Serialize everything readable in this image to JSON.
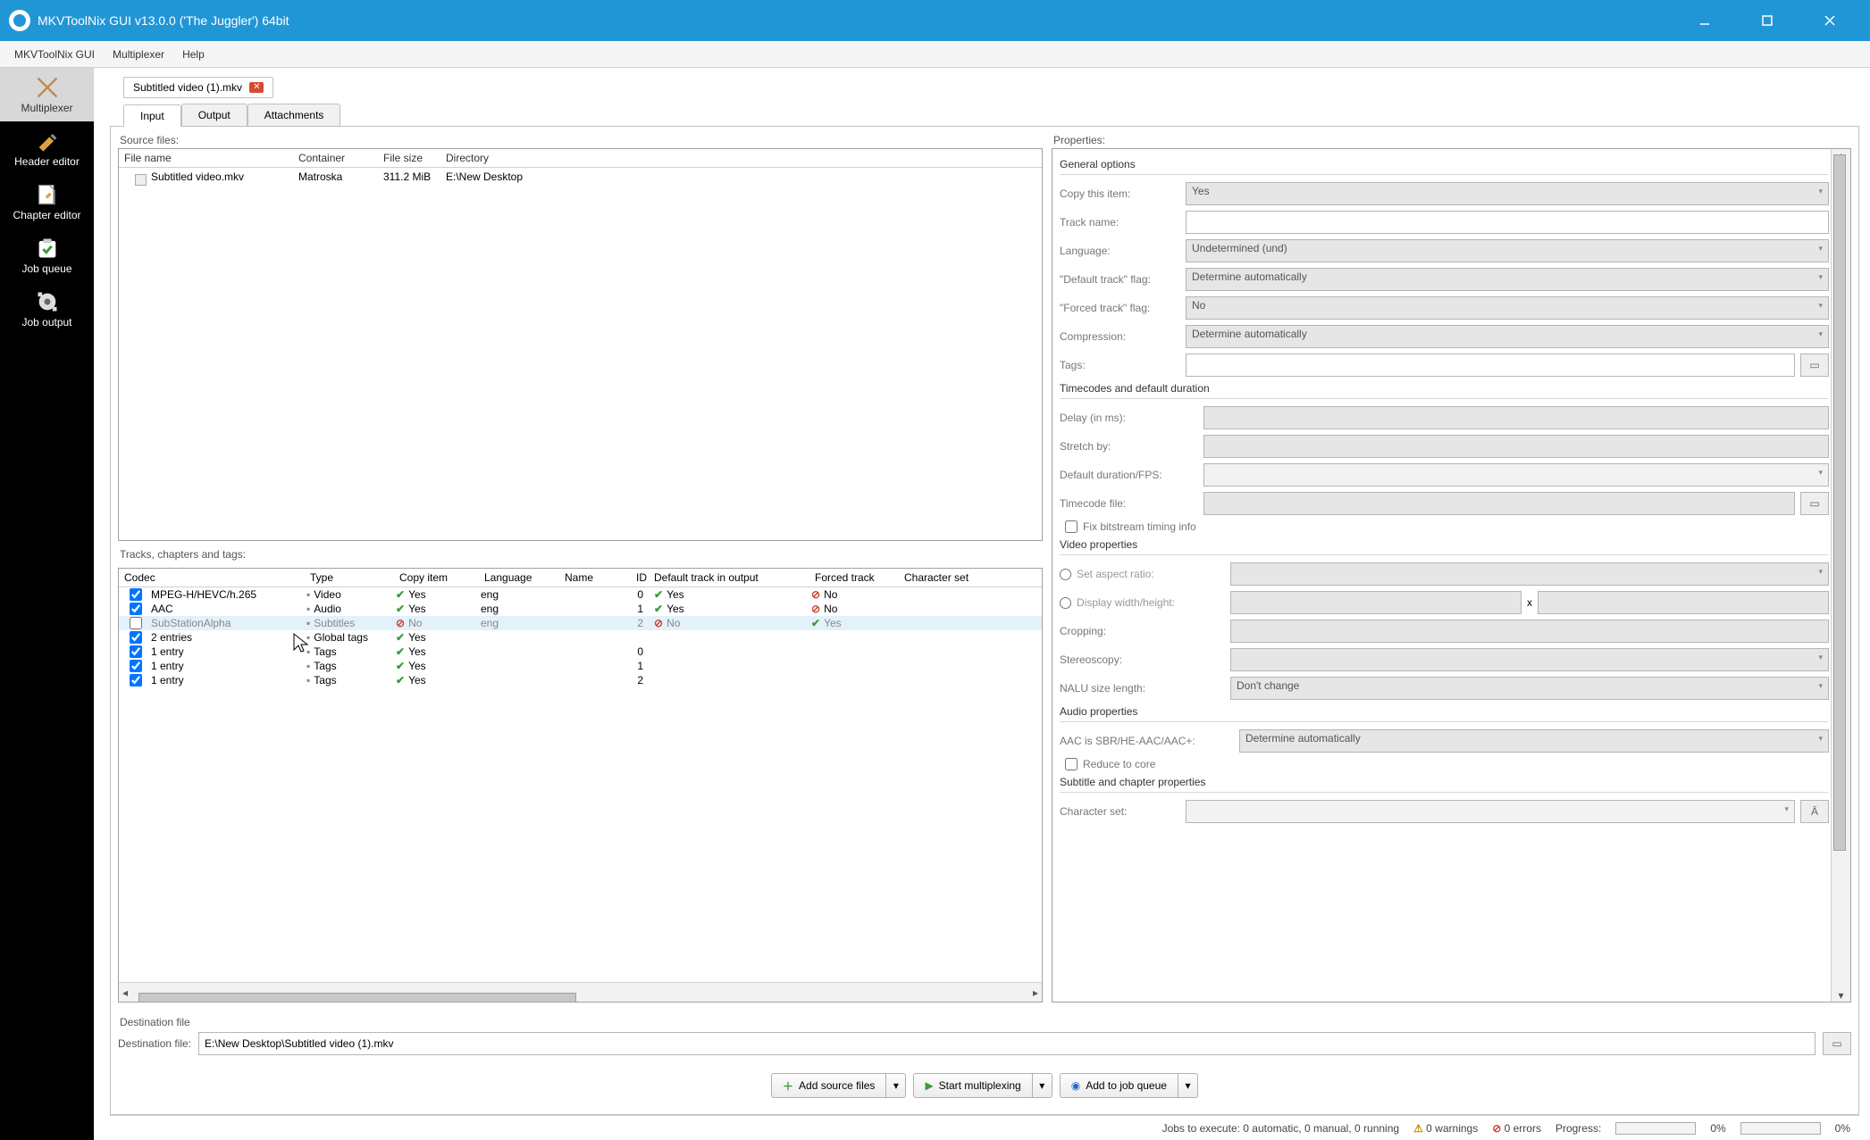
{
  "title": "MKVToolNix GUI v13.0.0 ('The Juggler') 64bit",
  "menu": {
    "app": "MKVToolNix GUI",
    "multiplexer": "Multiplexer",
    "help": "Help"
  },
  "sidebar": [
    {
      "label": "Multiplexer"
    },
    {
      "label": "Header editor"
    },
    {
      "label": "Chapter editor"
    },
    {
      "label": "Job queue"
    },
    {
      "label": "Job output"
    }
  ],
  "fileTab": {
    "name": "Subtitled video (1).mkv",
    "close": "✕"
  },
  "subTabs": {
    "input": "Input",
    "output": "Output",
    "attachments": "Attachments"
  },
  "labels": {
    "sourceFiles": "Source files:",
    "tracks": "Tracks, chapters and tags:",
    "properties": "Properties:",
    "destinationFile": "Destination file",
    "destField": "Destination file:"
  },
  "filesHeader": {
    "name": "File name",
    "container": "Container",
    "size": "File size",
    "dir": "Directory"
  },
  "filesRow": {
    "name": "Subtitled video.mkv",
    "container": "Matroska",
    "size": "311.2 MiB",
    "dir": "E:\\New Desktop"
  },
  "tracksHeader": {
    "codec": "Codec",
    "type": "Type",
    "copy": "Copy item",
    "lang": "Language",
    "name": "Name",
    "id": "ID",
    "def": "Default track in output",
    "forced": "Forced track",
    "char": "Character set"
  },
  "tracks": [
    {
      "chk": true,
      "codec": "MPEG-H/HEVC/h.265",
      "type": "Video",
      "copy": "Yes",
      "copyOk": true,
      "lang": "eng",
      "id": "0",
      "def": "Yes",
      "defOk": true,
      "forced": "No",
      "forcedOk": false
    },
    {
      "chk": true,
      "codec": "AAC",
      "type": "Audio",
      "copy": "Yes",
      "copyOk": true,
      "lang": "eng",
      "id": "1",
      "def": "Yes",
      "defOk": true,
      "forced": "No",
      "forcedOk": false
    },
    {
      "chk": false,
      "codec": "SubStationAlpha",
      "type": "Subtitles",
      "copy": "No",
      "copyOk": false,
      "lang": "eng",
      "id": "2",
      "def": "No",
      "defOk": false,
      "forced": "Yes",
      "forcedOk": true,
      "selected": true
    },
    {
      "chk": true,
      "codec": "2 entries",
      "type": "Global tags",
      "copy": "Yes",
      "copyOk": true,
      "lang": "",
      "id": "",
      "def": "",
      "forced": ""
    },
    {
      "chk": true,
      "codec": "1 entry",
      "type": "Tags",
      "copy": "Yes",
      "copyOk": true,
      "lang": "",
      "id": "0",
      "def": "",
      "forced": ""
    },
    {
      "chk": true,
      "codec": "1 entry",
      "type": "Tags",
      "copy": "Yes",
      "copyOk": true,
      "lang": "",
      "id": "1",
      "def": "",
      "forced": ""
    },
    {
      "chk": true,
      "codec": "1 entry",
      "type": "Tags",
      "copy": "Yes",
      "copyOk": true,
      "lang": "",
      "id": "2",
      "def": "",
      "forced": ""
    }
  ],
  "props": {
    "group_general": "General options",
    "copyItem": {
      "label": "Copy this item:",
      "value": "Yes"
    },
    "trackName": {
      "label": "Track name:",
      "value": ""
    },
    "language": {
      "label": "Language:",
      "value": "Undetermined (und)"
    },
    "defaultFlag": {
      "label": "\"Default track\" flag:",
      "value": "Determine automatically"
    },
    "forcedFlag": {
      "label": "\"Forced track\" flag:",
      "value": "No"
    },
    "compression": {
      "label": "Compression:",
      "value": "Determine automatically"
    },
    "tags": {
      "label": "Tags:",
      "value": ""
    },
    "group_timecodes": "Timecodes and default duration",
    "delay": {
      "label": "Delay (in ms):",
      "value": ""
    },
    "stretch": {
      "label": "Stretch by:",
      "value": ""
    },
    "fps": {
      "label": "Default duration/FPS:",
      "value": ""
    },
    "tcfile": {
      "label": "Timecode file:",
      "value": ""
    },
    "fixBitstream": "Fix bitstream timing info",
    "group_video": "Video properties",
    "setAspect": "Set aspect ratio:",
    "displayWH": "Display width/height:",
    "cropping": {
      "label": "Cropping:",
      "value": ""
    },
    "stereo": {
      "label": "Stereoscopy:",
      "value": ""
    },
    "nalu": {
      "label": "NALU size length:",
      "value": "Don't change"
    },
    "group_audio": "Audio properties",
    "aac": {
      "label": "AAC is SBR/HE-AAC/AAC+:",
      "value": "Determine automatically"
    },
    "reduceCore": "Reduce to core",
    "group_sub": "Subtitle and chapter properties",
    "charset": {
      "label": "Character set:",
      "value": ""
    },
    "x": "x"
  },
  "dest": {
    "value": "E:\\New Desktop\\Subtitled video (1).mkv"
  },
  "actions": {
    "add": "Add source files",
    "start": "Start multiplexing",
    "queue": "Add to job queue"
  },
  "status": {
    "jobs": "Jobs to execute: 0 automatic, 0 manual, 0 running",
    "warnings": "0 warnings",
    "errors": "0 errors",
    "progress": "Progress:",
    "pct": "0%"
  }
}
